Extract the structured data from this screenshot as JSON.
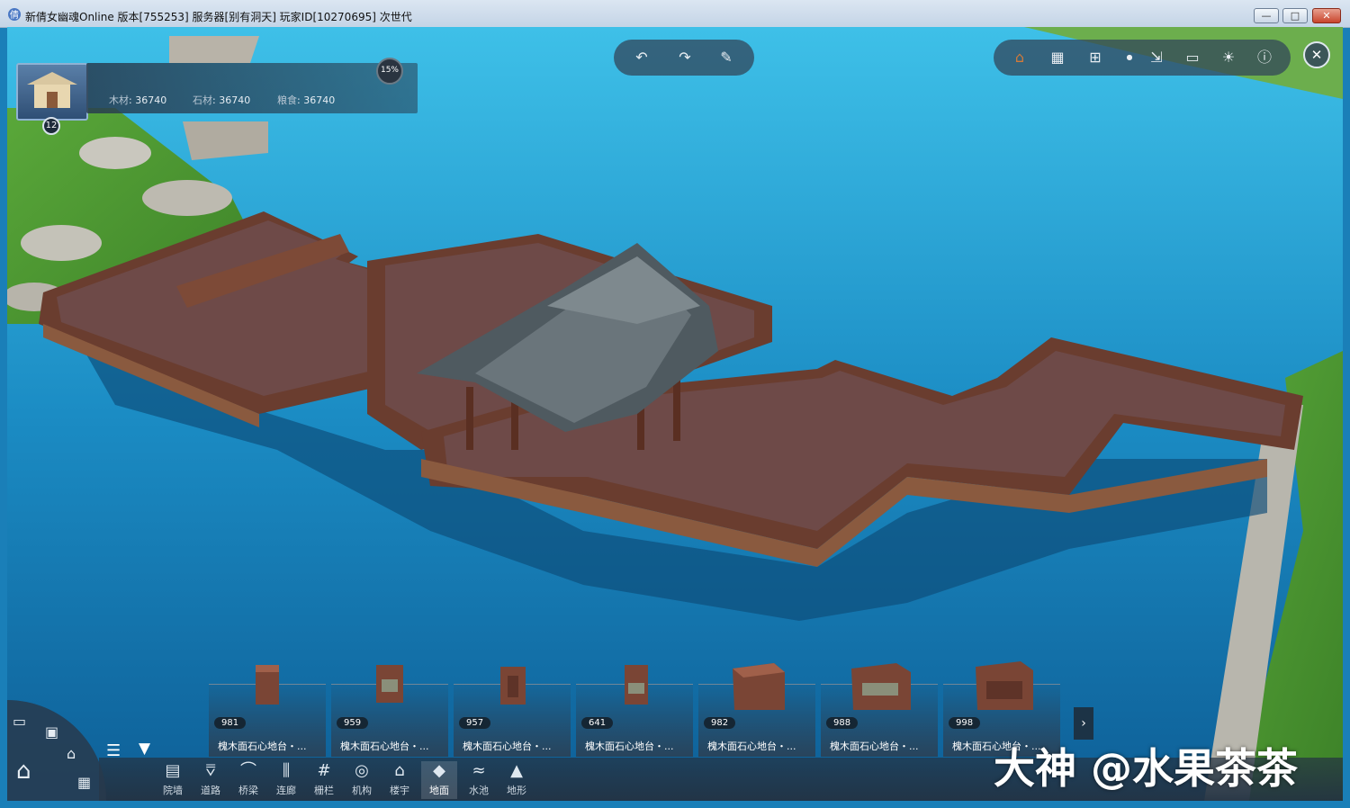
{
  "window": {
    "title": "新倩女幽魂Online 版本[755253] 服务器[别有洞天] 玩家ID[10270695] 次世代",
    "minimize": "—",
    "maximize": "□",
    "close": "✕"
  },
  "player": {
    "level": "12"
  },
  "resources": [
    {
      "label": "木材",
      "value": "36740"
    },
    {
      "label": "石材",
      "value": "36740"
    },
    {
      "label": "粮食",
      "value": "36740"
    }
  ],
  "progress": {
    "label": "15%",
    "value": 0.15
  },
  "edit_toolbar": {
    "icons": [
      "undo-icon",
      "redo-icon",
      "brush-icon"
    ]
  },
  "view_toolbar": {
    "icons": [
      "home-icon",
      "grid-icon",
      "layout-icon",
      "export-icon",
      "screen-icon",
      "sun-icon",
      "info-icon",
      "close-icon"
    ]
  },
  "items": [
    {
      "count": "981",
      "name": "槐木面石心地台・..."
    },
    {
      "count": "959",
      "name": "槐木面石心地台・..."
    },
    {
      "count": "957",
      "name": "槐木面石心地台・..."
    },
    {
      "count": "641",
      "name": "槐木面石心地台・..."
    },
    {
      "count": "982",
      "name": "槐木面石心地台・..."
    },
    {
      "count": "988",
      "name": "槐木面石心地台・..."
    },
    {
      "count": "998",
      "name": "槐木面石心地台・..."
    }
  ],
  "categories": [
    {
      "label": "院墙",
      "icon": "▤"
    },
    {
      "label": "道路",
      "icon": "⩢"
    },
    {
      "label": "桥梁",
      "icon": "⌒"
    },
    {
      "label": "连廊",
      "icon": "⫼"
    },
    {
      "label": "栅栏",
      "icon": "#"
    },
    {
      "label": "机构",
      "icon": "◎"
    },
    {
      "label": "楼宇",
      "icon": "⌂"
    },
    {
      "label": "地面",
      "icon": "◆"
    },
    {
      "label": "水池",
      "icon": "≈"
    },
    {
      "label": "地形",
      "icon": "▲"
    }
  ],
  "active_category": "地面",
  "watermark": "大神 @水果茶茶"
}
